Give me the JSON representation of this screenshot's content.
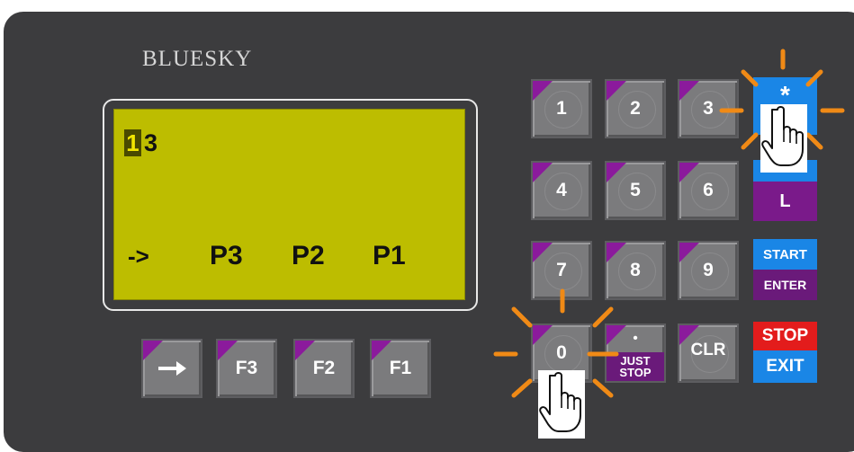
{
  "brand": "BLUESKY",
  "lcd": {
    "cursor_digit": "1",
    "line1_rest": "3",
    "arrow": "->",
    "p3": "P3",
    "p2": "P2",
    "p1": "P1"
  },
  "keypad": {
    "k1": "1",
    "k2": "2",
    "k3": "3",
    "k4": "4",
    "k5": "5",
    "k6": "6",
    "k7": "7",
    "k8": "8",
    "k9": "9",
    "k0": "0",
    "dot": "•",
    "just": "JUST",
    "stop": "STOP",
    "clr": "CLR"
  },
  "special": {
    "star": "*",
    "l": "L",
    "start": "START",
    "enter": "ENTER",
    "stop": "STOP",
    "exit": "EXIT"
  },
  "function_keys": {
    "f3": "F3",
    "f2": "F2",
    "f1": "F1"
  },
  "colors": {
    "panel": "#3c3c3e",
    "lcd": "#bdbd00",
    "key": "#7b7b7d",
    "corner": "#8b1a9c",
    "blue": "#1a86e6",
    "red": "#e31c1c",
    "burst": "#f08a16"
  }
}
